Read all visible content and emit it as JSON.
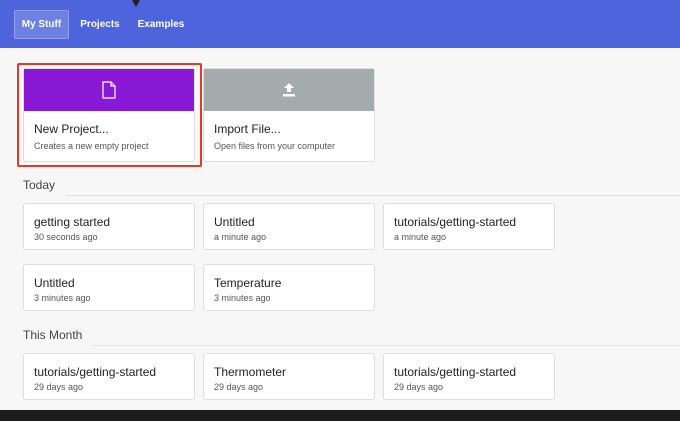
{
  "tabs": [
    {
      "label": "My Stuff",
      "active": true
    },
    {
      "label": "Projects",
      "active": false
    },
    {
      "label": "Examples",
      "active": false
    }
  ],
  "actions": {
    "new_project": {
      "title": "New Project...",
      "subtitle": "Creates a new empty project",
      "color": "#8a19d6",
      "icon": "file-icon"
    },
    "import_file": {
      "title": "Import File...",
      "subtitle": "Open files from your computer",
      "color": "#a5abab",
      "icon": "upload-icon"
    }
  },
  "sections": {
    "today": {
      "label": "Today",
      "items": [
        {
          "title": "getting started",
          "time": "30 seconds ago"
        },
        {
          "title": "Untitled",
          "time": "a minute ago"
        },
        {
          "title": "tutorials/getting-started",
          "time": "a minute ago"
        },
        {
          "title": "Untitled",
          "time": "3 minutes ago"
        },
        {
          "title": "Temperature",
          "time": "3 minutes ago"
        }
      ]
    },
    "this_month": {
      "label": "This Month",
      "items": [
        {
          "title": "tutorials/getting-started",
          "time": "29 days ago"
        },
        {
          "title": "Thermometer",
          "time": "29 days ago"
        },
        {
          "title": "tutorials/getting-started",
          "time": "29 days ago"
        }
      ]
    }
  },
  "colors": {
    "topbar": "#4d64dd",
    "highlight": "#e03a2a"
  }
}
